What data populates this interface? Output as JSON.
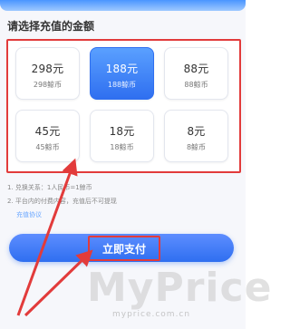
{
  "header": {
    "title": "请选择充值的金额"
  },
  "packages": [
    {
      "amount": "298元",
      "coins": "298鲸币"
    },
    {
      "amount": "188元",
      "coins": "188鲸币"
    },
    {
      "amount": "88元",
      "coins": "88鲸币"
    },
    {
      "amount": "45元",
      "coins": "45鲸币"
    },
    {
      "amount": "18元",
      "coins": "18鲸币"
    },
    {
      "amount": "8元",
      "coins": "8鲸币"
    }
  ],
  "selected_package": "188元",
  "notes": [
    "1. 兑换关系：1人民币=1鲸币",
    "2.          平台内的付费内容，充值后不可提现",
    "充值协议"
  ],
  "actions": {
    "pay_label": "立即支付"
  },
  "watermark": {
    "big": "MyPrice",
    "small": "myprice.com.cn"
  },
  "colors": {
    "accent_blue": "#2f6ff0",
    "highlight_red": "#e23b3b"
  }
}
